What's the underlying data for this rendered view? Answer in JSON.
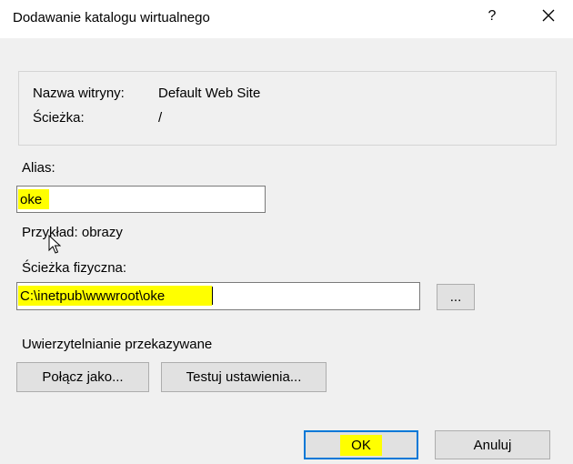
{
  "window": {
    "title": "Dodawanie katalogu wirtualnego",
    "help_glyph": "?",
    "close_icon": "close-icon"
  },
  "site_info": {
    "site_name_label": "Nazwa witryny:",
    "site_name_value": "Default Web Site",
    "path_label": "Ścieżka:",
    "path_value": "/"
  },
  "alias": {
    "label": "Alias:",
    "value": "oke",
    "example": "Przykład: obrazy"
  },
  "physical_path": {
    "label": "Ścieżka fizyczna:",
    "value": "C:\\inetpub\\wwwroot\\oke",
    "browse_label": "..."
  },
  "passthrough": {
    "label": "Uwierzytelnianie przekazywane",
    "connect_as_label": "Połącz jako...",
    "test_settings_label": "Testuj ustawienia..."
  },
  "footer": {
    "ok_label": "OK",
    "cancel_label": "Anuluj"
  },
  "colors": {
    "highlight": "#ffff00",
    "dialog_bg": "#f0f0f0",
    "default_button_border": "#0078d7"
  }
}
